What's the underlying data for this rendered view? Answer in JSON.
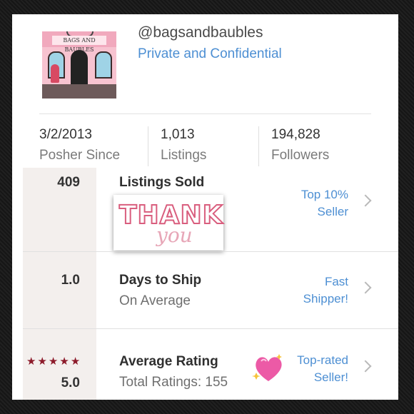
{
  "profile": {
    "username": "@bagsandbaubles",
    "subtitle": "Private and Confidential",
    "avatar_sign": "BAGS AND BAUBLES"
  },
  "stats": [
    {
      "value": "3/2/2013",
      "label": "Posher Since"
    },
    {
      "value": "1,013",
      "label": "Listings"
    },
    {
      "value": "194,828",
      "label": "Followers"
    }
  ],
  "metrics": [
    {
      "number": "409",
      "title": "Listings Sold",
      "subtitle": "",
      "badge_line1": "Top 10%",
      "badge_line2": "Seller"
    },
    {
      "number": "1.0",
      "title": "Days to Ship",
      "subtitle": "On Average",
      "badge_line1": "Fast",
      "badge_line2": "Shipper!"
    },
    {
      "number": "5.0",
      "title": "Average Rating",
      "subtitle": "Total Ratings: 155",
      "badge_line1": "Top-rated",
      "badge_line2": "Seller!"
    }
  ],
  "thank_you": {
    "line1": "THANK",
    "line2": "you"
  },
  "rating_stars": 5,
  "icons": [
    "chevron-right-icon",
    "sparkling-heart-icon",
    "star-icon"
  ],
  "colors": {
    "accent_blue": "#4d8fd3",
    "star_red": "#8c1a2a",
    "thank_pink": "#d95e7e"
  }
}
